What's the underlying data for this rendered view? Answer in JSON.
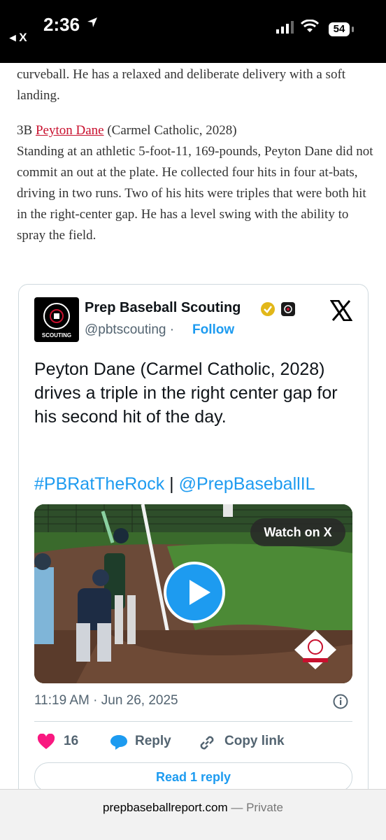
{
  "status_bar": {
    "time": "2:36",
    "back_label": "◂ X",
    "battery": "54"
  },
  "article": {
    "para1_lines": "curveball. He has a relaxed and deliberate delivery with a soft landing.",
    "position": "3B",
    "player_name": "Peyton Dane",
    "player_info": "(Carmel Catholic, 2028)",
    "para2": "Standing at an athletic 5-foot-11, 169-pounds, Peyton Dane did not commit an out at the plate. He collected four hits in four at-bats, driving in two runs. Two of his hits were triples that were both hit in the right-center gap. He has a level swing with the ability to spray the field."
  },
  "tweet": {
    "author_name": "Prep Baseball Scouting",
    "handle": "@pbtscouting",
    "separator": "·",
    "follow_label": "Follow",
    "avatar_text": "SCOUTING",
    "text": "Peyton Dane (Carmel Catholic, 2028) drives a triple in the right center gap for his second hit of the day.",
    "hashtag": "#PBRatTheRock",
    "divider": "|",
    "mention": "@PrepBaseballIL",
    "watch_label": "Watch on X",
    "timestamp": "11:19 AM · Jun 26, 2025",
    "likes": "16",
    "reply_label": "Reply",
    "copy_label": "Copy link",
    "read_reply_label": "Read 1 reply"
  },
  "bottom_bar": {
    "domain": "prepbaseballreport.com",
    "private_label": "— Private"
  },
  "colors": {
    "accent": "#1d9bf0",
    "link": "#c8102e",
    "heart": "#f91880"
  }
}
